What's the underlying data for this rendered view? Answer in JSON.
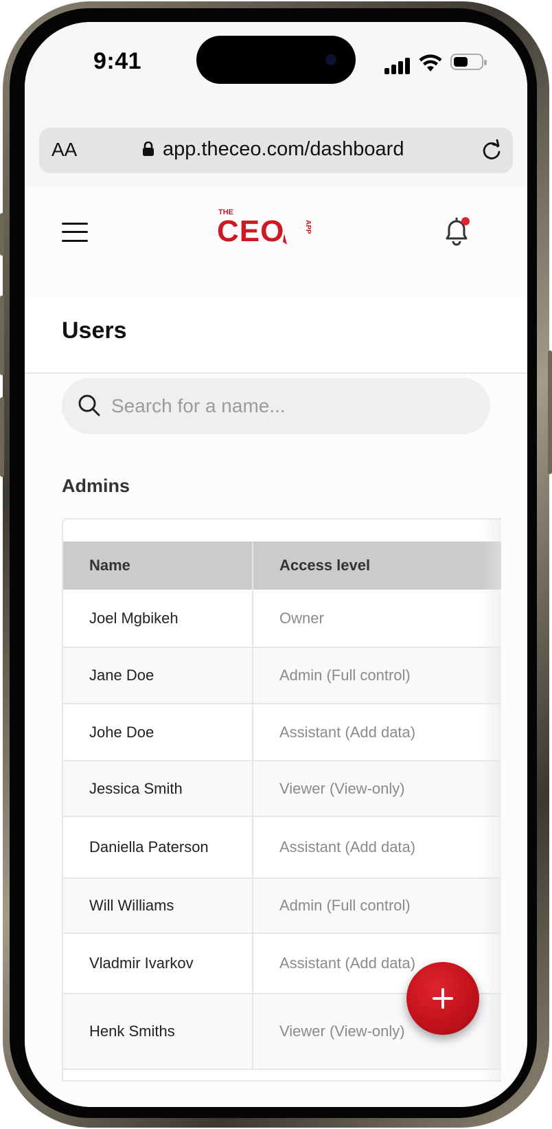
{
  "status_bar": {
    "time": "9:41"
  },
  "browser": {
    "url": "app.theceo.com/dashboard",
    "text_size_label": "AA"
  },
  "header": {
    "logo_text": "CEO",
    "logo_small": "THE",
    "logo_side": "APP",
    "brand_color": "#cc1a24"
  },
  "page": {
    "title": "Users"
  },
  "search": {
    "placeholder": "Search for a name..."
  },
  "section": {
    "title": "Admins"
  },
  "table": {
    "columns": [
      "Name",
      "Access level"
    ],
    "rows": [
      {
        "name": "Joel Mgbikeh",
        "access": "Owner"
      },
      {
        "name": "Jane Doe",
        "access": "Admin (Full control)"
      },
      {
        "name": "Johe Doe",
        "access": "Assistant (Add data)"
      },
      {
        "name": "Jessica Smith",
        "access": "Viewer (View-only)"
      },
      {
        "name": "Daniella Paterson",
        "access": "Assistant (Add data)"
      },
      {
        "name": "Will Williams",
        "access": "Admin (Full control)"
      },
      {
        "name": "Vladmir Ivarkov",
        "access": "Assistant (Add data)"
      },
      {
        "name": "Henk Smiths",
        "access": "Viewer (View-only)"
      }
    ]
  },
  "fab": {
    "icon": "plus-icon",
    "color": "#c3121c"
  }
}
